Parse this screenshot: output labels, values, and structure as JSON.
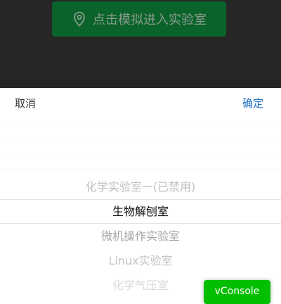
{
  "background": {
    "enter_button_label": "点击模拟进入实验室",
    "enter_button_icon": "location-pin-icon"
  },
  "sheet": {
    "cancel_label": "取消",
    "confirm_label": "确定",
    "options": [
      "化学实验室一(已禁用)",
      "生物解刨室",
      "微机操作实验室",
      "Linux实验室",
      "化学气压室"
    ],
    "selected_option": "生物解刨室"
  },
  "vconsole_label": "vConsole",
  "colors": {
    "overlay": "#262626",
    "enter_button": "#09632a",
    "confirm": "#1a6fc0",
    "vconsole": "#04be02"
  }
}
